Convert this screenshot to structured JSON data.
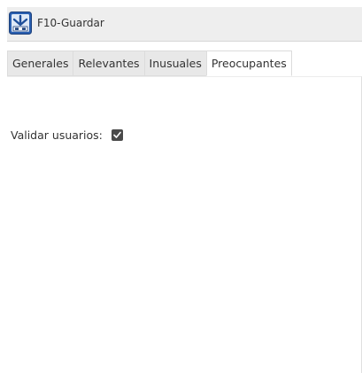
{
  "toolbar": {
    "save_label": "F10-Guardar",
    "save_icon": "save-icon"
  },
  "tabs": [
    {
      "label": "Generales",
      "active": false
    },
    {
      "label": "Relevantes",
      "active": false
    },
    {
      "label": "Inusuales",
      "active": false
    },
    {
      "label": "Preocupantes",
      "active": true
    }
  ],
  "form": {
    "validate_users_label": "Validar usuarios:",
    "validate_users_checked": true
  },
  "colors": {
    "toolbar_bg": "#eeeeee",
    "tab_bg": "#e8e8e8",
    "active_tab_bg": "#ffffff",
    "checkbox_fill": "#4a4a4a"
  }
}
